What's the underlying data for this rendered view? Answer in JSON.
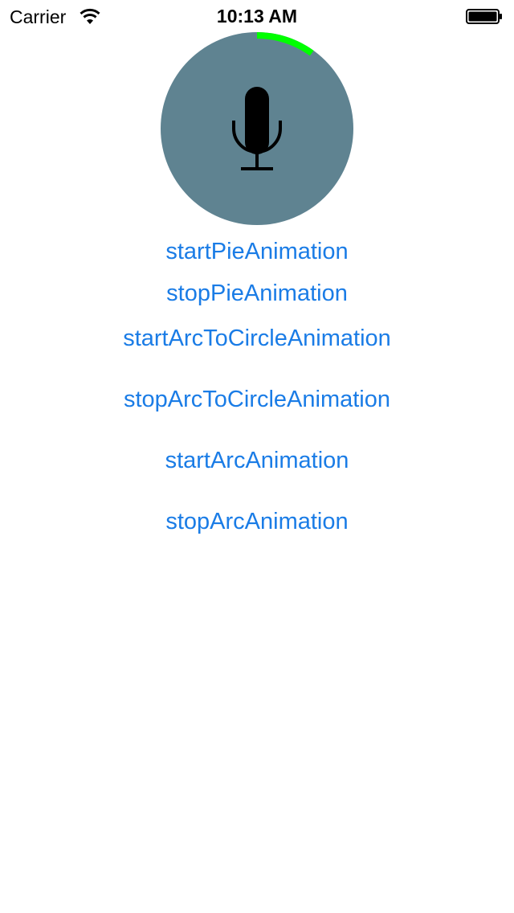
{
  "status_bar": {
    "carrier": "Carrier",
    "time": "10:13 AM",
    "wifi_icon": "wifi-icon",
    "battery_icon": "battery-icon"
  },
  "mic_widget": {
    "icon": "microphone-icon",
    "circle_color": "#5f8391",
    "progress_color": "#00ff00",
    "progress_fraction": 0.1
  },
  "buttons": {
    "start_pie": "startPieAnimation",
    "stop_pie": "stopPieAnimation",
    "start_arc_to_circle": "startArcToCircleAnimation",
    "stop_arc_to_circle": "stopArcToCircleAnimation",
    "start_arc": "startArcAnimation",
    "stop_arc": "stopArcAnimation"
  },
  "colors": {
    "link": "#1a7ce6"
  }
}
